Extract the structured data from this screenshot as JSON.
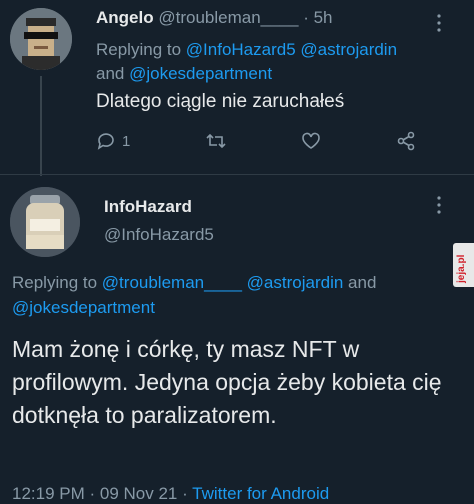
{
  "reply_tweet": {
    "display_name": "Angelo",
    "handle": "@troubleman____",
    "time": "· 5h",
    "replying_prefix": "Replying to",
    "replying_user1": "@InfoHazard5",
    "replying_user2": "@astrojardin",
    "replying_and": "and",
    "replying_user3": "@jokesdepartment",
    "text": "Dlatego ciągle nie zaruchałeś",
    "reply_count": "1"
  },
  "main_tweet": {
    "display_name": "InfoHazard",
    "handle": "@InfoHazard5",
    "replying_prefix": "Replying to",
    "replying_user1": "@troubleman____",
    "replying_user2": "@astrojardin",
    "replying_and": "and",
    "replying_user3": "@jokesdepartment",
    "text": "Mam żonę i córkę, ty masz NFT w profilowym. Jedyna opcja żeby kobieta cię dotknęła to paralizatorem.",
    "timestamp": "12:19 PM · 09 Nov 21 · ",
    "source": "Twitter for Android"
  },
  "watermark": "jeja.pl",
  "colors": {
    "background": "#15202b",
    "accent": "#1d9bf0",
    "muted": "#8899a6"
  },
  "icons": [
    "reply-icon",
    "retweet-icon",
    "like-icon",
    "share-icon",
    "more-icon"
  ]
}
